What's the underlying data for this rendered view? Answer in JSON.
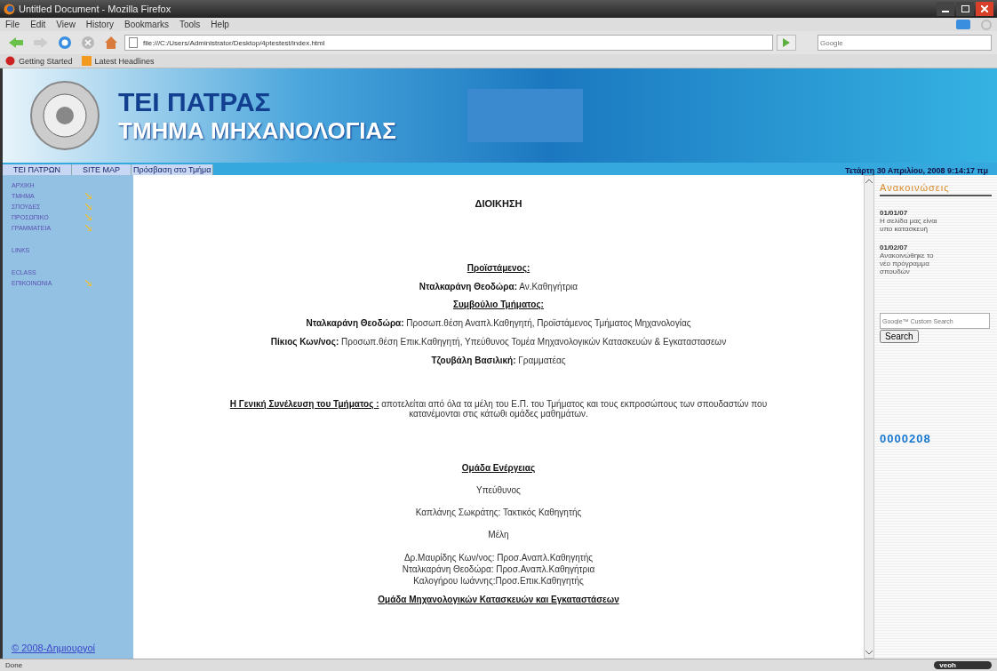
{
  "window": {
    "title": "Untitled Document - Mozilla Firefox"
  },
  "menu": [
    "File",
    "Edit",
    "View",
    "History",
    "Bookmarks",
    "Tools",
    "Help"
  ],
  "address": {
    "value": "file:///C:/Users/Administrator/Desktop/4ptestest/index.html"
  },
  "search": {
    "placeholder": "Google"
  },
  "bookmarks": [
    "Getting Started",
    "Latest Headlines"
  ],
  "banner": {
    "title": "TEI ΠΑΤΡΑΣ",
    "subtitle": "ΤΜΗΜΑ ΜΗΧΑΝΟΛΟΓΙΑΣ"
  },
  "nav": [
    "TEI ΠΑΤΡΩΝ",
    "SITE MAP",
    "Πρόσβαση στο Τμήμα"
  ],
  "date": "Τετάρτη 30 Απριλίου, 2008 9:14:17 πμ",
  "sidebar": {
    "groups": [
      [
        {
          "label": "ΑΡΧΙΚΗ",
          "submenu": false
        },
        {
          "label": "ΤΜΗΜΑ",
          "submenu": true
        },
        {
          "label": "ΣΠΟΥΔΕΣ",
          "submenu": true
        },
        {
          "label": "ΠΡΟΣΩΠΙΚΟ",
          "submenu": true
        },
        {
          "label": "ΓΡΑΜΜΑΤΕΙΑ",
          "submenu": true
        }
      ],
      [
        {
          "label": "LINKS",
          "submenu": false
        }
      ],
      [
        {
          "label": "ECLASS",
          "submenu": false
        },
        {
          "label": "ΕΠΙΚΟΙΝΩΝΙΑ",
          "submenu": true
        }
      ]
    ],
    "footer": "© 2008-Δημιουργοί"
  },
  "content": [
    {
      "kind": "title",
      "text": "ΔΙΟΙΚΗΣΗ"
    },
    {
      "kind": "heading",
      "text": "Προϊστάμενος:"
    },
    {
      "kind": "entry",
      "name": "Νταλκαράνη Θεοδώρα:",
      "text": "Αν.Καθηγήτρια"
    },
    {
      "kind": "heading",
      "text": "Συμβούλιο Τμήματος:"
    },
    {
      "kind": "entry",
      "name": "Νταλκαράνη Θεοδώρα:",
      "text": "Προσωπ.θέση Αναπλ.Καθηγητή, Προϊστάμενος Τμήματος Μηχανολογίας"
    },
    {
      "kind": "entry",
      "name": "Πίκιος Κων/νος:",
      "text": "Προσωπ.θέση Επικ.Καθηγητή, Υπεύθυνος Τομέα Μηχανολογικών Κατασκευών & Εγκαταστασεων"
    },
    {
      "kind": "entry",
      "name": "Τζουβάλη Βασιλική:",
      "text": "Γραμματέας"
    },
    {
      "kind": "lead",
      "name": "Η Γενική Συνέλευση του Τμήματος :",
      "text": "αποτελείται από όλα τα μέλη του Ε.Π. του Τμήματος και τους εκπροσώπους των σπουδαστών που κατανέμονται στις κάτωθι ομάδες μαθημάτων."
    },
    {
      "kind": "group",
      "text": "Ομάδα  Ενέργειας"
    },
    {
      "kind": "text",
      "text": "Υπεύθυνος"
    },
    {
      "kind": "text",
      "text": "Καπλάνης Σωκράτης: Τακτικός  Καθηγητής"
    },
    {
      "kind": "text",
      "text": "Μέλη"
    },
    {
      "kind": "lines",
      "lines": [
        "Δρ.Μαυρίδης Κων/νος: Προσ.Αναπλ.Καθηγητής",
        "Νταλκαράνη Θεοδώρα: Προσ.Αναπλ.Καθηγήτρια",
        "Καλογήρου Ιωάννης:Προσ.Επικ.Καθηγητής"
      ]
    },
    {
      "kind": "group",
      "text": "Ομάδα Μηχανολογικών Κατασκευών και Εγκαταστάσεων"
    }
  ],
  "announcements": {
    "title": "Ανακοινώσεις",
    "items": [
      {
        "date": "01/01/07",
        "text": "Η σελίδα μας είναι υπο κατασκευή"
      },
      {
        "date": "01/02/07",
        "text": "Ανακοινώθηκε το νέο πρόγραμμα σπουδών"
      }
    ]
  },
  "custom_search": {
    "placeholder": "Google™ Custom Search",
    "button": "Search"
  },
  "counter": "0000208",
  "status_bar": {
    "text": "Done",
    "widget": "veoh"
  }
}
